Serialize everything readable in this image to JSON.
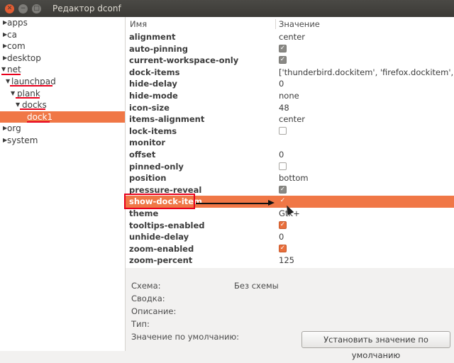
{
  "window": {
    "title": "Редактор dconf",
    "controls": [
      "close-icon",
      "minimize-icon",
      "maximize-icon"
    ]
  },
  "tree": {
    "nodes": [
      {
        "label": "apps",
        "expanded": false,
        "selected": false
      },
      {
        "label": "ca",
        "expanded": false,
        "selected": false
      },
      {
        "label": "com",
        "expanded": false,
        "selected": false
      },
      {
        "label": "desktop",
        "expanded": false,
        "selected": false
      },
      {
        "label": "net",
        "expanded": true,
        "selected": false
      },
      {
        "label": "launchpad",
        "expanded": true,
        "selected": false
      },
      {
        "label": "plank",
        "expanded": true,
        "selected": false
      },
      {
        "label": "docks",
        "expanded": true,
        "selected": false
      },
      {
        "label": "dock1",
        "expanded": false,
        "selected": true
      },
      {
        "label": "org",
        "expanded": false,
        "selected": false
      },
      {
        "label": "system",
        "expanded": false,
        "selected": false
      }
    ]
  },
  "table": {
    "columns": {
      "name": "Имя",
      "value": "Значение"
    },
    "rows": [
      {
        "key": "alignment",
        "value": "center",
        "type": "text"
      },
      {
        "key": "auto-pinning",
        "type": "check",
        "checked": true
      },
      {
        "key": "current-workspace-only",
        "type": "check",
        "checked": true
      },
      {
        "key": "dock-items",
        "value": "['thunderbird.dockitem', 'firefox.dockitem', 'rhythmbox.dockitem']",
        "type": "text"
      },
      {
        "key": "hide-delay",
        "value": "0",
        "type": "text"
      },
      {
        "key": "hide-mode",
        "value": "none",
        "type": "text"
      },
      {
        "key": "icon-size",
        "value": "48",
        "type": "text"
      },
      {
        "key": "items-alignment",
        "value": "center",
        "type": "text"
      },
      {
        "key": "lock-items",
        "type": "check",
        "checked": false
      },
      {
        "key": "monitor",
        "value": "",
        "type": "text"
      },
      {
        "key": "offset",
        "value": "0",
        "type": "text"
      },
      {
        "key": "pinned-only",
        "type": "check",
        "checked": false
      },
      {
        "key": "position",
        "value": "bottom",
        "type": "text"
      },
      {
        "key": "pressure-reveal",
        "type": "check",
        "checked": true
      },
      {
        "key": "show-dock-item",
        "type": "check",
        "checked": true,
        "selected": true
      },
      {
        "key": "theme",
        "value": "Gtk+",
        "type": "text"
      },
      {
        "key": "tooltips-enabled",
        "type": "check",
        "checked": true,
        "accent": true
      },
      {
        "key": "unhide-delay",
        "value": "0",
        "type": "text"
      },
      {
        "key": "zoom-enabled",
        "type": "check",
        "checked": true,
        "accent": true
      },
      {
        "key": "zoom-percent",
        "value": "125",
        "type": "text"
      }
    ]
  },
  "details": {
    "schema_label": "Схема:",
    "schema_value": "Без схемы",
    "summary_label": "Сводка:",
    "description_label": "Описание:",
    "type_label": "Тип:",
    "default_label": "Значение по умолчанию:",
    "reset_button": "Установить значение по умолчанию"
  },
  "colors": {
    "selection": "#f07746",
    "annotation": "#e8001c",
    "titlebar": "#3b3a36"
  }
}
